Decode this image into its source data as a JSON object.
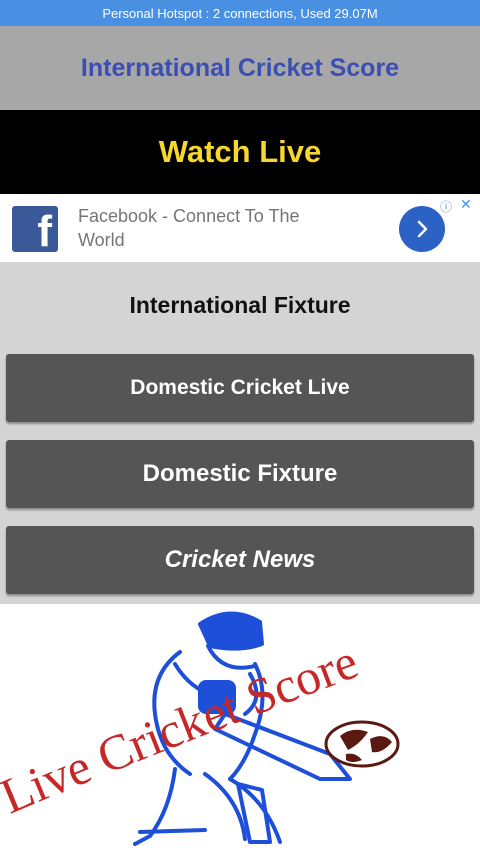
{
  "status_bar": {
    "text": "Personal Hotspot : 2 connections, Used 29.07M"
  },
  "header": {
    "title": "International Cricket Score"
  },
  "watch_live": {
    "label": "Watch Live"
  },
  "ad": {
    "text": "Facebook - Connect To The World",
    "logo_letter": "f"
  },
  "menu": {
    "fixture": "International Fixture",
    "items": [
      {
        "label": "Domestic Cricket Live"
      },
      {
        "label": "Domestic Fixture"
      },
      {
        "label": "Cricket News"
      }
    ]
  },
  "logo": {
    "caption": "Live Cricket Score"
  },
  "colors": {
    "status_bar": "#4a90e2",
    "header_bg": "#a7a7a7",
    "title": "#3b4fb3",
    "watch_live_text": "#f7d62e",
    "button_bg": "#555555",
    "logo_blue": "#1d4fd8",
    "logo_red": "#c62828"
  }
}
